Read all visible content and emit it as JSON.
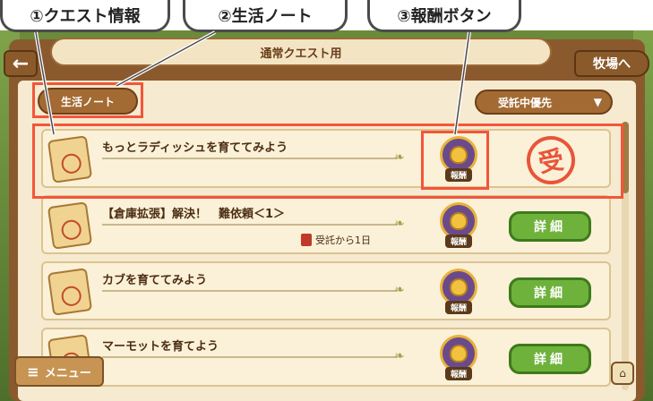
{
  "callouts": [
    {
      "label": "①クエスト情報"
    },
    {
      "label": "②生活ノート"
    },
    {
      "label": "③報酬ボタン"
    }
  ],
  "header": {
    "title": "通常クエスト用",
    "back_icon": "arrow-left-icon",
    "ranch_label": "牧場へ"
  },
  "filters": {
    "note_label": "生活ノート",
    "sort_label": "受託中優先",
    "sort_icon": "triangle-down-icon"
  },
  "quests": [
    {
      "title": "もっとラディッシュを育ててみよう",
      "sub": "",
      "reward_label": "報酬",
      "action": "stamp",
      "stamp_text": "受"
    },
    {
      "title": "【倉庫拡張】解決！　難依頼＜1＞",
      "sub": "受託から1日",
      "reward_label": "報酬",
      "action": "detail",
      "detail_label": "詳細"
    },
    {
      "title": "カブを育ててみよう",
      "sub": "",
      "reward_label": "報酬",
      "action": "detail",
      "detail_label": "詳細"
    },
    {
      "title": "マーモットを育てよう",
      "sub": "",
      "reward_label": "報酬",
      "action": "detail",
      "detail_label": "詳細"
    }
  ],
  "footer": {
    "menu_label": "メニュー",
    "menu_icon": "hamburger-icon",
    "collapse_icon": "collapse-icon"
  },
  "colors": {
    "highlight": "#f2563a",
    "detail_green": "#6fb23b",
    "wood": "#8a5a2e"
  }
}
